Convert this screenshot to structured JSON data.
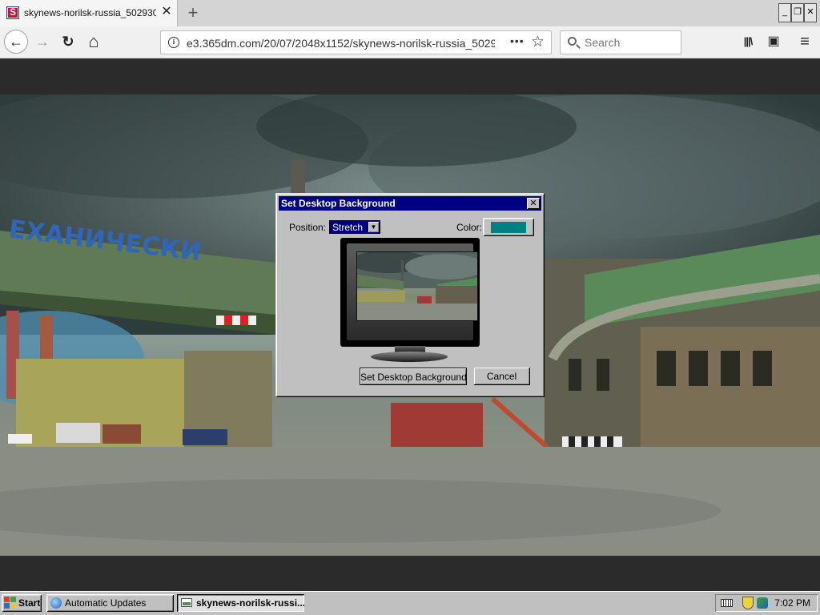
{
  "browser": {
    "tab_title": "skynews-norilsk-russia_5029302.jpg",
    "url": "e3.365dm.com/20/07/2048x1152/skynews-norilsk-russia_5029302.jpg",
    "search_placeholder": "Search",
    "icons": {
      "favicon": "S",
      "tab_close": "✕",
      "new_tab": "+",
      "back": "←",
      "forward": "→",
      "reload": "↻",
      "home": "⌂",
      "info": "i",
      "page_actions": "•••",
      "bookmark": "☆",
      "library": "|||\\",
      "sidebar": "▣",
      "menu": "≡",
      "minimize": "_",
      "restore": "❐",
      "close": "✕"
    }
  },
  "photo": {
    "sign_text": "ЕХАНИЧЕСКИ"
  },
  "dialog": {
    "title": "Set Desktop Background",
    "close_glyph": "✕",
    "position_label": "Position:",
    "position_value": "Stretch",
    "dropdown_glyph": "▼",
    "color_label": "Color:",
    "color_value": "#008080",
    "set_button_label": "Set Desktop Background",
    "cancel_button_label": "Cancel"
  },
  "taskbar": {
    "start_label": "Start",
    "tasks": [
      {
        "label": "Automatic Updates"
      },
      {
        "label": "skynews-norilsk-russi..."
      }
    ],
    "clock": "7:02 PM"
  }
}
